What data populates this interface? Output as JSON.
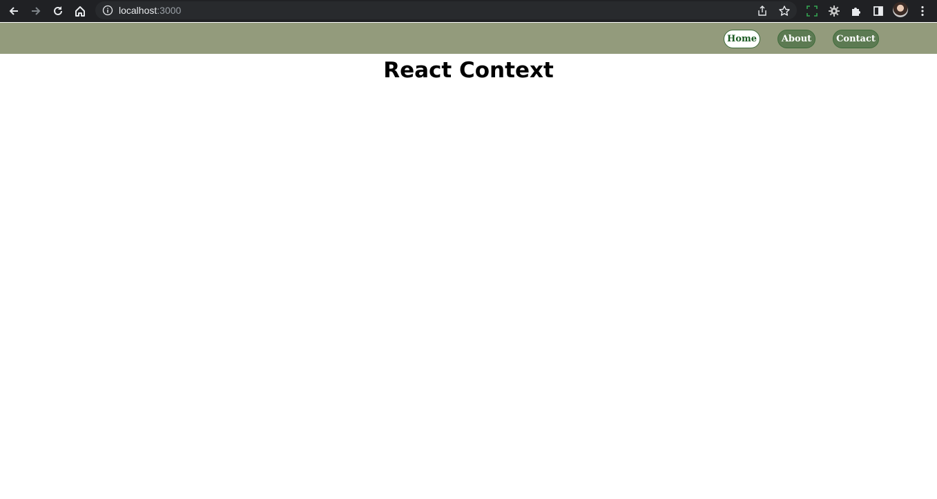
{
  "browser": {
    "url_host": "localhost",
    "url_port": ":3000",
    "icons": [
      "back-icon",
      "forward-icon",
      "reload-icon",
      "home-icon",
      "info-icon",
      "share-icon",
      "star-icon",
      "extension-screenshot-icon",
      "extension-gear-icon",
      "puzzle-icon",
      "side-panel-icon",
      "avatar",
      "menu-dots-icon"
    ]
  },
  "navbar": {
    "background": "#939b7c",
    "links": [
      {
        "label": "Home",
        "active": true
      },
      {
        "label": "About",
        "active": false
      },
      {
        "label": "Contact",
        "active": false
      }
    ]
  },
  "main": {
    "title": "React Context"
  }
}
